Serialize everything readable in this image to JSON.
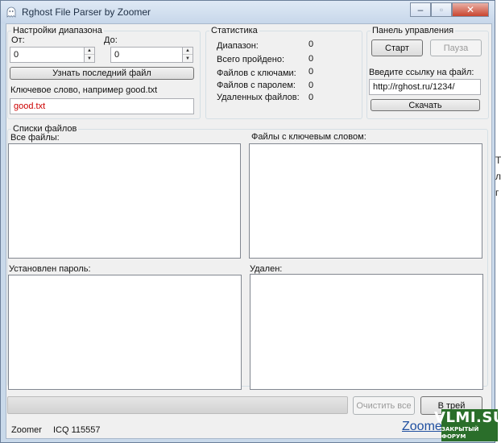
{
  "window": {
    "title": "Rghost File Parser by Zoomer",
    "controls": {
      "minimize": "‒",
      "maximize": "▫",
      "close": "✕"
    }
  },
  "range": {
    "group_label": "Настройки диапазона",
    "from_label": "От:",
    "to_label": "До:",
    "from_value": "0",
    "to_value": "0",
    "last_file_button": "Узнать последний файл",
    "keyword_label": "Ключевое слово, например good.txt",
    "keyword_value": "good.txt",
    "keyword_color": "#cc0000"
  },
  "stats": {
    "group_label": "Статистика",
    "rows": [
      {
        "label": "Диапазон:",
        "value": "0"
      },
      {
        "label": "Всего пройдено:",
        "value": "0"
      },
      {
        "label": "Файлов с ключами:",
        "value": "0"
      },
      {
        "label": "Файлов с паролем:",
        "value": "0"
      },
      {
        "label": "Удаленных файлов:",
        "value": "0"
      }
    ]
  },
  "control": {
    "group_label": "Панель управления",
    "start_button": "Старт",
    "pause_button": "Пауза",
    "link_label": "Введите ссылку на файл:",
    "link_value": "http://rghost.ru/1234/",
    "download_button": "Скачать"
  },
  "lists": {
    "group_label": "Списки файлов",
    "all_files_label": "Все файлы:",
    "keyword_files_label": "Файлы с ключевым словом:",
    "password_label": "Установлен пароль:",
    "deleted_label": "Удален:"
  },
  "bottom": {
    "progress_fraction": 0,
    "clear_button": "Очистить все",
    "tray_button": "В трей"
  },
  "status": {
    "author": "Zoomer",
    "icq": "ICQ 115557"
  },
  "background": {
    "link_text": "Zoomer",
    "side_chars": [
      "Т",
      "л",
      "г"
    ]
  },
  "watermark": {
    "logo_text": "VLMI.SU",
    "logo_subtext": "ЗАКРЫТЫЙ ФОРУМ"
  }
}
